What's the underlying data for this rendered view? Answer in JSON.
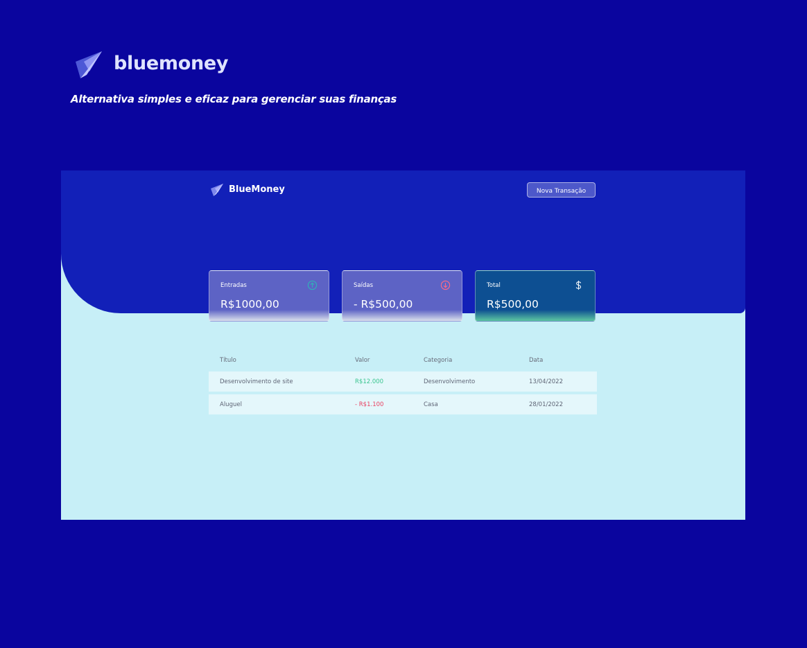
{
  "brand": {
    "name": "bluemoney",
    "tagline": "Alternativa simples e eficaz para gerenciar suas finanças",
    "logo_icon": "paper-plane-icon"
  },
  "app": {
    "name": "BlueMoney",
    "new_transaction_label": "Nova Transação",
    "colors": {
      "page_background": "#0a059e",
      "header_background": "#1220b8",
      "content_background": "#c7eff7",
      "income_accent": "#39c58f",
      "expense_accent": "#e94061"
    }
  },
  "summary": [
    {
      "label": "Entradas",
      "value": "R$1000,00",
      "icon": "arrow-circle-up-icon"
    },
    {
      "label": "Saídas",
      "value": "- R$500,00",
      "icon": "arrow-circle-down-icon"
    },
    {
      "label": "Total",
      "value": "R$500,00",
      "icon": "dollar-sign-icon"
    }
  ],
  "table": {
    "headers": [
      "Título",
      "Valor",
      "Categoria",
      "Data"
    ],
    "rows": [
      {
        "title": "Desenvolvimento de site",
        "value": "R$12.000",
        "category": "Desenvolvimento",
        "date": "13/04/2022"
      },
      {
        "title": "Aluguel",
        "value": "- R$1.100",
        "category": "Casa",
        "date": "28/01/2022"
      }
    ]
  }
}
